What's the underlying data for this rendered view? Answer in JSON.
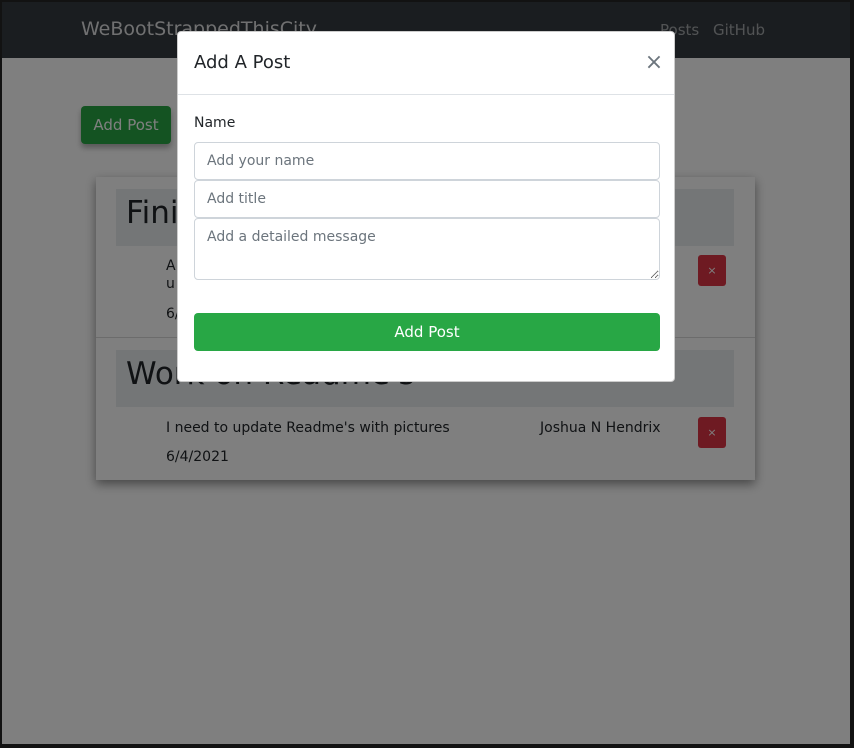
{
  "navbar": {
    "brand": "WeBootStrappedThisCity",
    "links": [
      "Posts",
      "GitHub"
    ]
  },
  "page": {
    "add_post_label": "Add Post"
  },
  "posts": [
    {
      "title": "Fini",
      "message_line1": "A",
      "message_line2": "u",
      "author": "",
      "date": "6/",
      "delete_label": "×"
    },
    {
      "title": "Work on Readme's",
      "message_line1": "I need to update Readme's with pictures",
      "author": "Joshua N Hendrix",
      "date": "6/4/2021",
      "delete_label": "×"
    }
  ],
  "modal": {
    "title": "Add A Post",
    "close_label": "×",
    "name_label": "Name",
    "name_placeholder": "Add your name",
    "title_placeholder": "Add title",
    "message_placeholder": "Add a detailed message",
    "submit_label": "Add Post"
  },
  "colors": {
    "success": "#28a745",
    "danger": "#dc3545",
    "navbar": "#343a40"
  }
}
